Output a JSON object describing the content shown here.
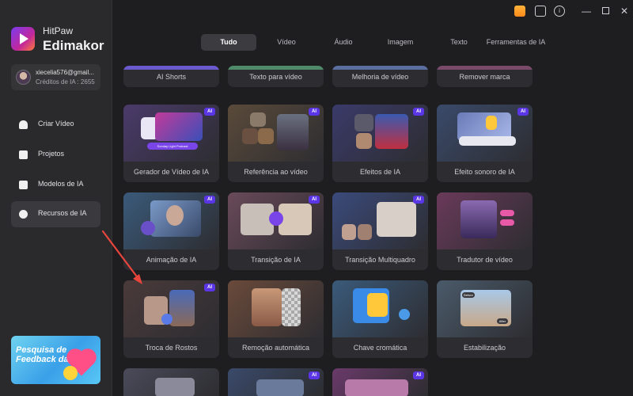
{
  "app": {
    "brand_line1": "HitPaw",
    "brand_line2": "Edimakor"
  },
  "user": {
    "email": "xiecelia576@gmail...",
    "credits": "Créditos de IA : 2655"
  },
  "nav": {
    "items": [
      {
        "label": "Criar Vídeo",
        "icon": "create-video-icon",
        "active": false
      },
      {
        "label": "Projetos",
        "icon": "projects-icon",
        "active": false
      },
      {
        "label": "Modelos de IA",
        "icon": "ai-models-icon",
        "active": false
      },
      {
        "label": "Recursos de IA",
        "icon": "ai-resources-icon",
        "active": true
      }
    ]
  },
  "feedback": {
    "text": "Pesquisa de Feedback da"
  },
  "tabs": [
    "Tudo",
    "Vídeo",
    "Áudio",
    "Imagem",
    "Texto",
    "Ferramentas de IA"
  ],
  "active_tab": "Tudo",
  "ai_badge": "AI",
  "cards_top": [
    "AI Shorts",
    "Texto para vídeo",
    "Melhoria de vídeo",
    "Remover marca"
  ],
  "cards": [
    [
      "Gerador de Vídeo de IA",
      "Referência ao vídeo",
      "Efeitos de IA",
      "Efeito sonoro de IA"
    ],
    [
      "Animação de IA",
      "Transição de IA",
      "Transição Multiquadro",
      "Tradutor de vídeo"
    ],
    [
      "Troca de Rostos",
      "Remoção automática",
      "Chave cromática",
      "Estabilização"
    ]
  ],
  "thumb_captions": {
    "podcast": "Sunday Light Podcast",
    "before": "Before",
    "after": "After"
  },
  "colors": {
    "accent": "#5a36e6",
    "sidebar": "#2a2a2d",
    "background": "#1e1e20",
    "card": "#2d2d31",
    "pointer_arrow": "#e8453c"
  }
}
